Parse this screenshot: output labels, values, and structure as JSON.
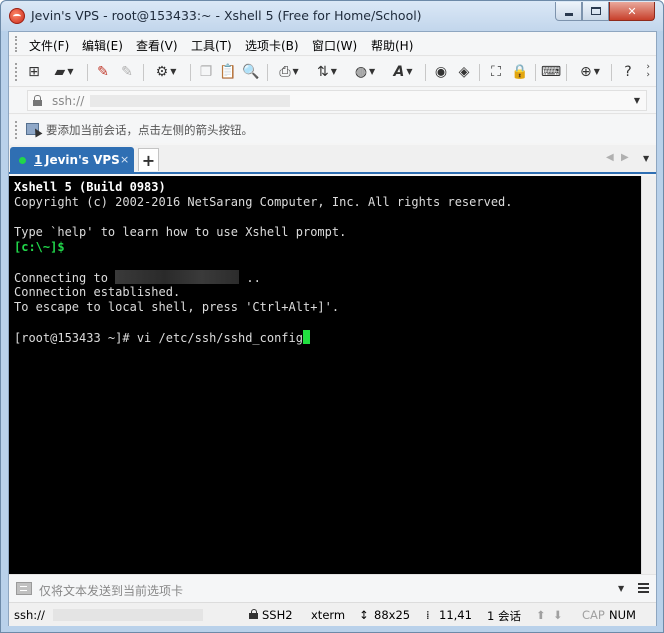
{
  "window": {
    "title": "Jevin's VPS - root@153433:~ - Xshell 5 (Free for Home/School)"
  },
  "menu": [
    "文件(F)",
    "编辑(E)",
    "查看(V)",
    "工具(T)",
    "选项卡(B)",
    "窗口(W)",
    "帮助(H)"
  ],
  "address": {
    "text": "ssh://"
  },
  "hint": {
    "text": "要添加当前会话，点击左侧的箭头按钮。"
  },
  "tab": {
    "number": "1",
    "label": "Jevin's VPS",
    "close": "×",
    "add": "+"
  },
  "terminal": {
    "lines": [
      "Xshell 5 (Build 0983)",
      "Copyright (c) 2002-2016 NetSarang Computer, Inc. All rights reserved.",
      "Type `help' to learn how to use Xshell prompt.",
      "[c:\\~]$",
      "Connecting to ",
      " ..",
      "Connection established.",
      "To escape to local shell, press 'Ctrl+Alt+]'.",
      "[root@153433 ~]# vi /etc/ssh/sshd_config"
    ]
  },
  "sendbar": {
    "placeholder": "仅将文本发送到当前选项卡"
  },
  "status": {
    "connection": "ssh://",
    "protocol": "SSH2",
    "terminal_type": "xterm",
    "size": "88x25",
    "cursor_pos": "11,41",
    "sessions": "1 会话",
    "caps": "CAP",
    "num": "NUM"
  },
  "colors": {
    "tab_active": "#2f6fb3",
    "terminal_bg": "#000000",
    "prompt_green": "#21d64a",
    "cursor": "#21e040"
  }
}
